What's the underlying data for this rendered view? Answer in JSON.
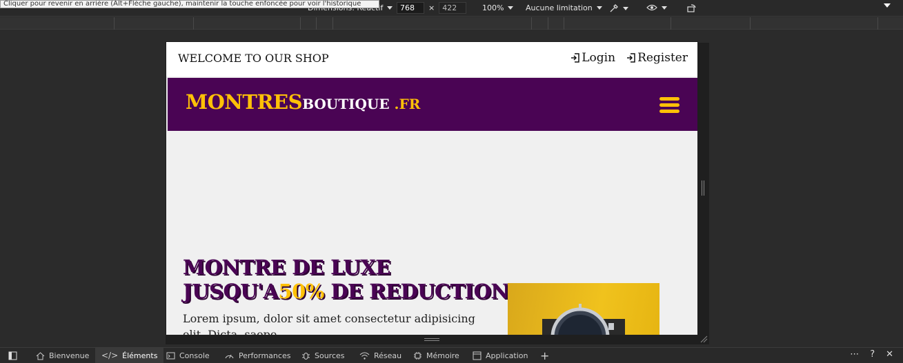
{
  "tooltip": "Cliquer pour revenir en arrière (Alt+Flèche gauche), maintenir la touche enfoncée pour voir l'historique",
  "device_toolbar": {
    "dimensions_label": "Dimensions: Réactif",
    "width": "768",
    "times": "×",
    "height": "422",
    "zoom": "100%",
    "throttling": "Aucune limitation"
  },
  "page": {
    "topbar": {
      "welcome": "WELCOME TO OUR SHOP",
      "login": "Login",
      "register": "Register"
    },
    "logo": {
      "big": "MONTRES",
      "small": "BOUTIQUE",
      "tld": " .FR"
    },
    "hero": {
      "line1": "MONTRE DE LUXE",
      "line2_pre": "JUSQU'A",
      "line2_accent": "50%",
      "line2_post": " DE REDUCTION",
      "text": "Lorem ipsum, dolor sit amet consectetur adipisicing elit. Dicta, saepe"
    }
  },
  "tabs": [
    {
      "label": "Bienvenue",
      "icon": "home-icon"
    },
    {
      "label": "Éléments",
      "icon": "code-icon"
    },
    {
      "label": "Console",
      "icon": "console-icon"
    },
    {
      "label": "Performances",
      "icon": "gauge-icon"
    },
    {
      "label": "Sources",
      "icon": "bug-icon"
    },
    {
      "label": "Réseau",
      "icon": "wifi-icon"
    },
    {
      "label": "Mémoire",
      "icon": "chip-icon"
    },
    {
      "label": "Application",
      "icon": "window-icon"
    }
  ],
  "colors": {
    "brand_purple": "#4a0454",
    "brand_yellow": "#ffc107"
  }
}
